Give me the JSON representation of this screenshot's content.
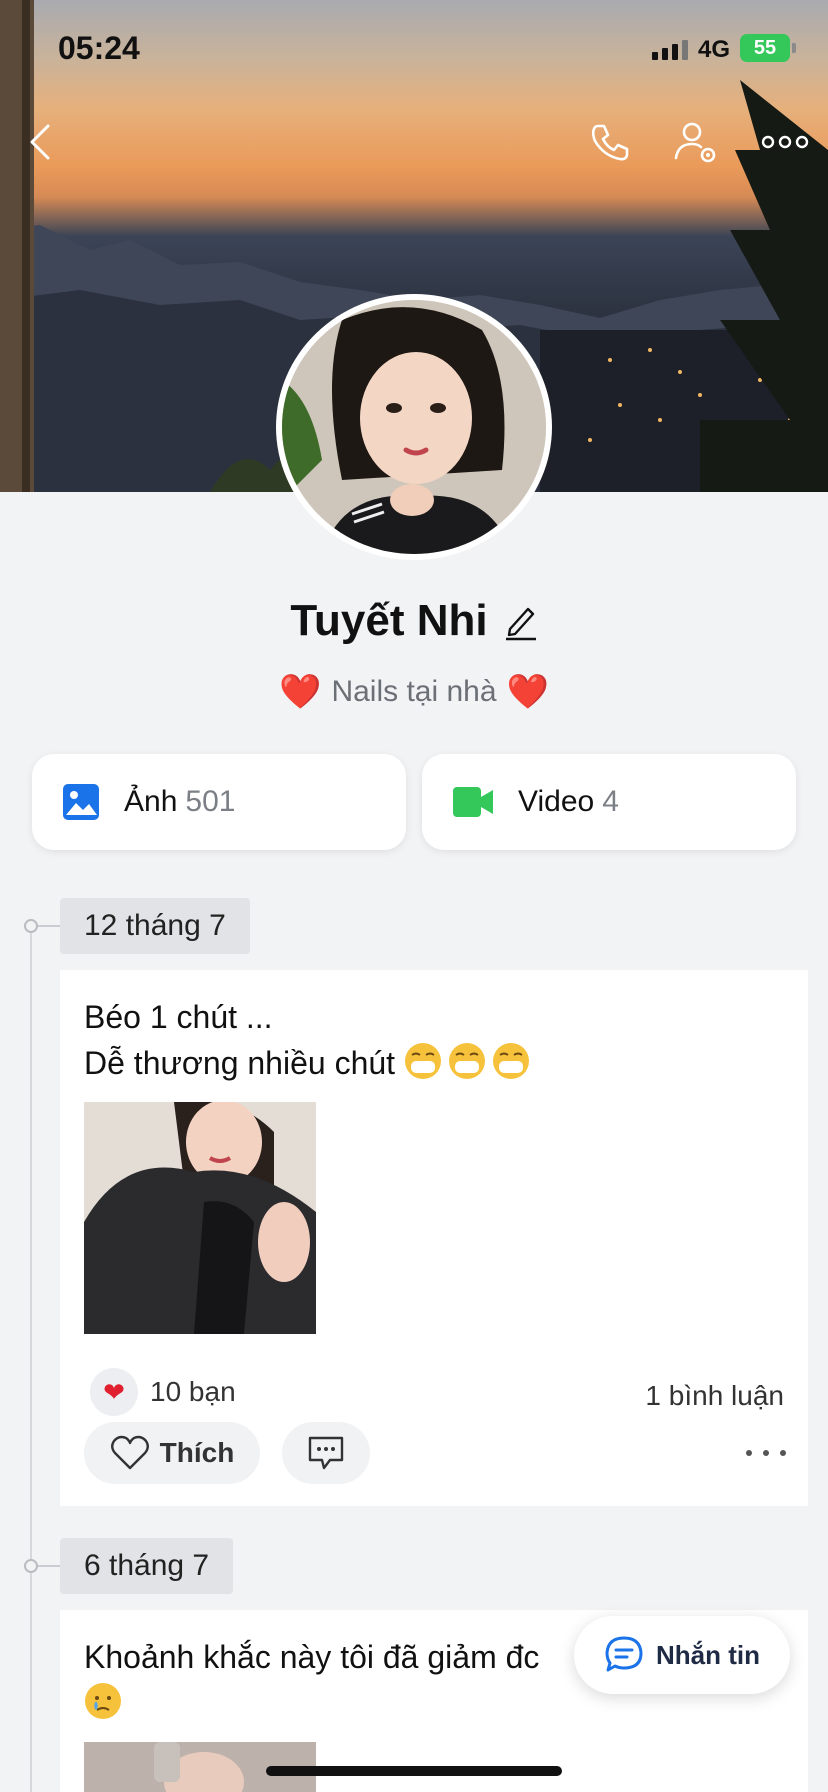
{
  "status_bar": {
    "time": "05:24",
    "network": "4G",
    "battery": "55"
  },
  "profile": {
    "name": "Tuyết Nhi",
    "bio": "Nails tại nhà",
    "bio_emoji": "❤️"
  },
  "media": {
    "photos": {
      "label": "Ảnh",
      "count": "501"
    },
    "videos": {
      "label": "Video",
      "count": "4"
    }
  },
  "timeline": [
    {
      "date": "12 tháng 7",
      "text_line1": "Béo 1 chút ...",
      "text_line2": "Dễ thương nhiều chút",
      "reaction_count": "10 bạn",
      "comment_count": "1 bình luận",
      "like_label": "Thích"
    },
    {
      "date": "6 tháng 7",
      "text_line1": "Khoảnh khắc này tôi đã giảm đc"
    }
  ],
  "fab": {
    "label": "Nhắn tin"
  },
  "colors": {
    "accent_blue": "#1a73e8",
    "video_green": "#34c759",
    "heart_red": "#d3202a"
  }
}
